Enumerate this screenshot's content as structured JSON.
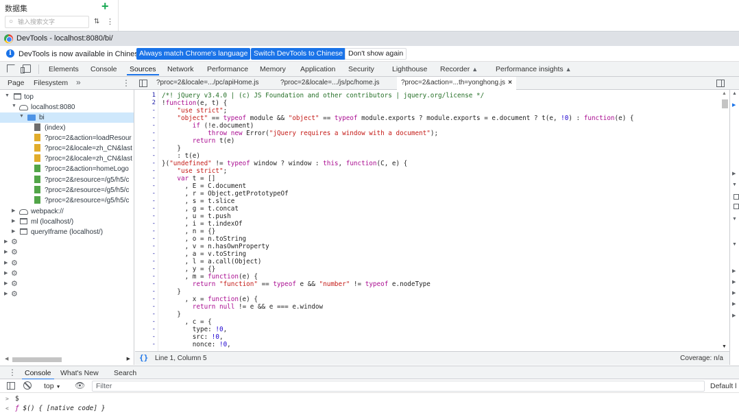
{
  "app_panel": {
    "title": "数据集",
    "search_placeholder": "输入搜索文字",
    "sort_icon": "sort-icon",
    "more_icon": "more-icon"
  },
  "devtools": {
    "title": "DevTools - localhost:8080/bi/"
  },
  "infobar": {
    "message": "DevTools is now available in Chinese!",
    "match_button": "Always match Chrome's language",
    "switch_button": "Switch DevTools to Chinese",
    "dont_show_button": "Don't show again"
  },
  "main_tabs": [
    "Elements",
    "Console",
    "Sources",
    "Network",
    "Performance",
    "Memory",
    "Application",
    "Security",
    "Lighthouse",
    "Recorder",
    "Performance insights"
  ],
  "active_main_tab": "Sources",
  "navigator_tabs": [
    "Page",
    "Filesystem"
  ],
  "file_tabs": [
    "?proc=2&locale=.../pc/apiHome.js",
    "?proc=2&locale=.../js/pc/home.js",
    "?proc=2&action=...th=yonghong.js"
  ],
  "tree": {
    "top": "top",
    "host": "localhost:8080",
    "folder": "bi",
    "files": [
      "(index)",
      "?proc=2&action=loadResour",
      "?proc=2&locale=zh_CN&last",
      "?proc=2&locale=zh_CN&last",
      "?proc=2&action=homeLogo",
      "?proc=2&resource=/g5/h5/c",
      "?proc=2&resource=/g5/h5/c",
      "?proc=2&resource=/g5/h5/c"
    ],
    "others": [
      "webpack://",
      "ml (localhost/)",
      "queryIframe (localhost/)"
    ]
  },
  "code": {
    "line_numbers": [
      "1",
      "2",
      "-",
      "-",
      "-",
      "-",
      "-",
      "-",
      "-",
      "-",
      "-",
      "-",
      "-",
      "-",
      "-",
      "-",
      "-",
      "-",
      "-",
      "-",
      "-",
      "-",
      "-",
      "-",
      "-",
      "-",
      "-",
      "-",
      "-",
      "-",
      "-",
      "-",
      "-",
      "-"
    ],
    "lines": [
      "/*! jQuery v3.4.0 | (c) JS Foundation and other contributors | jquery.org/license */",
      "!function(e, t) {",
      "    \"use strict\";",
      "    \"object\" == typeof module && \"object\" == typeof module.exports ? module.exports = e.document ? t(e, !0) : function(e) {",
      "        if (!e.document)",
      "            throw new Error(\"jQuery requires a window with a document\");",
      "        return t(e)",
      "    }",
      "    : t(e)",
      "}(\"undefined\" != typeof window ? window : this, function(C, e) {",
      "    \"use strict\";",
      "    var t = []",
      "      , E = C.document",
      "      , r = Object.getPrototypeOf",
      "      , s = t.slice",
      "      , g = t.concat",
      "      , u = t.push",
      "      , i = t.indexOf",
      "      , n = {}",
      "      , o = n.toString",
      "      , v = n.hasOwnProperty",
      "      , a = v.toString",
      "      , l = a.call(Object)",
      "      , y = {}",
      "      , m = function(e) {",
      "        return \"function\" == typeof e && \"number\" != typeof e.nodeType",
      "    }",
      "      , x = function(e) {",
      "        return null != e && e === e.window",
      "    }",
      "      , c = {",
      "        type: !0,",
      "        src: !0,",
      "        nonce: !0,"
    ]
  },
  "status": {
    "cursor": "Line 1, Column 5",
    "coverage": "Coverage: n/a"
  },
  "drawer_tabs": [
    "Console",
    "What's New",
    "Search"
  ],
  "console_toolbar": {
    "context": "top",
    "filter_placeholder": "Filter",
    "levels": "Default l"
  },
  "console_output": {
    "input": "$",
    "result_keyword": "ƒ",
    "result_text": " $() { [native code] }"
  },
  "colors": {
    "accent": "#1a73e8",
    "keyword": "#aa0d91",
    "string": "#c41a16",
    "comment": "#236e25"
  }
}
